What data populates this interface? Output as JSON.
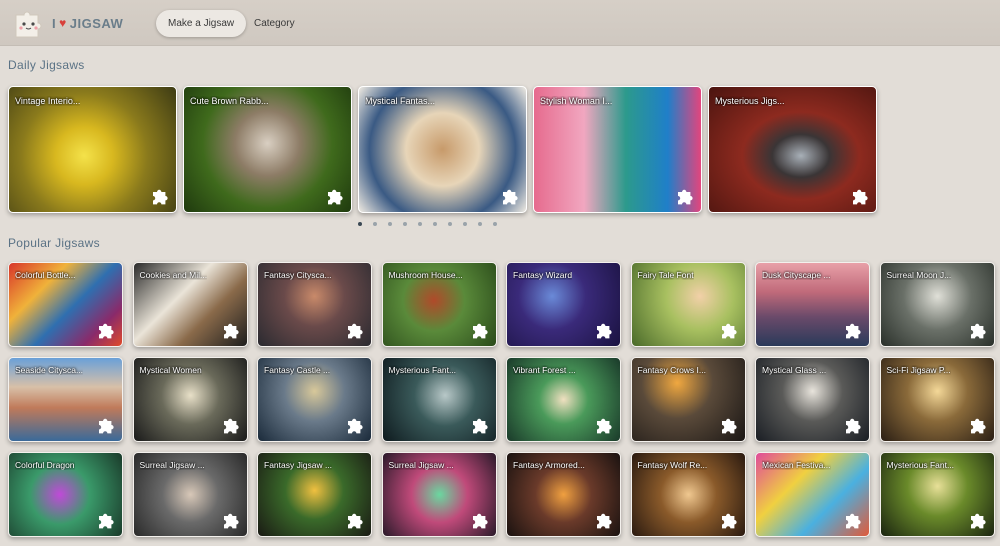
{
  "header": {
    "logo_text": "JIGSAW",
    "logo_prefix": "I",
    "nav": [
      {
        "label": "Make a Jigsaw",
        "active": true
      },
      {
        "label": "Category",
        "active": false
      }
    ]
  },
  "daily": {
    "title": "Daily Jigsaws",
    "items": [
      {
        "label": "Vintage Interio...",
        "bg": "radial-gradient(circle at 45% 55%, #f4e24a 0%, #d8b81f 25%, #8a7a1c 55%, #3d3b14 100%)"
      },
      {
        "label": "Cute Brown Rabb...",
        "bg": "radial-gradient(circle at 50% 45%, #d9cfc2 0%, #8d7c66 30%, #3f6a1c 60%, #1f3a0e 100%)"
      },
      {
        "label": "Mystical Fantas...",
        "bg": "radial-gradient(circle at 50% 50%, #c79a6a 0%, #e7d5b8 35%, #3a5a84 70%, #f0ebe2 100%)"
      },
      {
        "label": "Stylish Woman I...",
        "bg": "linear-gradient(90deg, #e66b8e 0%, #f1a7c0 30%, #2c9a8c 55%, #1f7fc9 80%, #e3457d 100%)"
      },
      {
        "label": "Mysterious Jigs...",
        "bg": "radial-gradient(ellipse at 55% 55%, #a8b0b8 0%, #3a3536 22%, #8d2a1f 45%, #4a140f 100%)"
      }
    ],
    "dots": 10,
    "active_dot": 0
  },
  "popular": {
    "title": "Popular Jigsaws",
    "items": [
      {
        "label": "Colorful Bottle...",
        "bg": "linear-gradient(135deg, #d8352a 0%, #f0b23a 30%, #2f6fb0 55%, #8a2a6a 80%, #e04a2a 100%)"
      },
      {
        "label": "Cookies and Mil...",
        "bg": "linear-gradient(135deg, #2a2a2a 0%, #eae4d8 40%, #8a6a4a 65%, #1e1e1e 100%)"
      },
      {
        "label": "Fantasy Citysca...",
        "bg": "radial-gradient(circle at 50% 40%, #c98a6a 0%, #6a4a4a 40%, #2a2a30 100%)"
      },
      {
        "label": "Mushroom House...",
        "bg": "radial-gradient(circle at 45% 45%, #b04a2a 0%, #5a8a3a 40%, #2a4a1a 100%)"
      },
      {
        "label": "Fantasy Wizard",
        "bg": "radial-gradient(circle at 40% 40%, #6a8ad8 0%, #3a2a7a 40%, #1a1240 100%)"
      },
      {
        "label": "Fairy Tale Font",
        "bg": "radial-gradient(circle at 60% 40%, #f2d0a8 0%, #a8c060 40%, #4a6a2a 100%)"
      },
      {
        "label": "Dusk Cityscape ...",
        "bg": "linear-gradient(180deg, #e8a0a8 0%, #c06a7a 35%, #6a4a6a 65%, #2a3a5a 100%)"
      },
      {
        "label": "Surreal Moon J...",
        "bg": "radial-gradient(circle at 50% 40%, #e0e0d8 0%, #6a7068 45%, #2a302a 100%)"
      },
      {
        "label": "Seaside Citysca...",
        "bg": "linear-gradient(180deg, #6aa0d8 0%, #d8c0a8 35%, #c07a5a 60%, #3a6a9a 100%)"
      },
      {
        "label": "Mystical Women",
        "bg": "radial-gradient(circle at 50% 45%, #e8e0c8 0%, #6a6a5a 40%, #1a1a1a 100%)"
      },
      {
        "label": "Fantasy Castle ...",
        "bg": "radial-gradient(circle at 50% 40%, #d8c89a 0%, #6a7a8a 40%, #1a2a3a 100%)"
      },
      {
        "label": "Mysterious Fant...",
        "bg": "radial-gradient(circle at 55% 45%, #b8c8c8 0%, #3a5a5a 40%, #0e1a1e 100%)"
      },
      {
        "label": "Vibrant Forest ...",
        "bg": "radial-gradient(circle at 50% 50%, #f0e0c0 0%, #4a9a5a 35%, #1a3a2a 100%)"
      },
      {
        "label": "Fantasy Crows I...",
        "bg": "radial-gradient(circle at 40% 30%, #f0a840 0%, #5a4a3a 40%, #1a1614 100%)"
      },
      {
        "label": "Mystical Glass ...",
        "bg": "radial-gradient(circle at 50% 40%, #e8e4dc 0%, #5a5a58 40%, #1a1e24 100%)"
      },
      {
        "label": "Sci-Fi Jigsaw P...",
        "bg": "radial-gradient(circle at 50% 40%, #f4d898 0%, #8a6a3a 40%, #2a1e14 100%)"
      },
      {
        "label": "Colorful Dragon",
        "bg": "radial-gradient(circle at 45% 50%, #c04ad8 0%, #3a9a6a 40%, #1a3a2a 100%)"
      },
      {
        "label": "Surreal Jigsaw ...",
        "bg": "radial-gradient(circle at 50% 50%, #d8c8b8 0%, #6a6a6a 40%, #2a2a2a 100%)"
      },
      {
        "label": "Fantasy Jigsaw ...",
        "bg": "radial-gradient(circle at 50% 45%, #f0c040 0%, #3a6a2a 40%, #1a1a14 100%)"
      },
      {
        "label": "Surreal Jigsaw ...",
        "bg": "radial-gradient(circle at 50% 50%, #6ad8a0 0%, #c04a7a 40%, #2a1a2a 100%)"
      },
      {
        "label": "Fantasy Armored...",
        "bg": "radial-gradient(circle at 50% 50%, #f0a040 0%, #6a3a2a 40%, #1a1210 100%)"
      },
      {
        "label": "Fantasy Wolf Re...",
        "bg": "radial-gradient(circle at 50% 50%, #f0c890 0%, #8a5a2a 40%, #2a1a10 100%)"
      },
      {
        "label": "Mexican Festiva...",
        "bg": "linear-gradient(135deg, #e04a9a 0%, #f0d040 35%, #4ab0e0 65%, #e05a3a 100%)"
      },
      {
        "label": "Mysterious Fant...",
        "bg": "radial-gradient(circle at 50% 40%, #e8e098 0%, #6a8a2a 40%, #1a2410 100%)"
      }
    ]
  }
}
